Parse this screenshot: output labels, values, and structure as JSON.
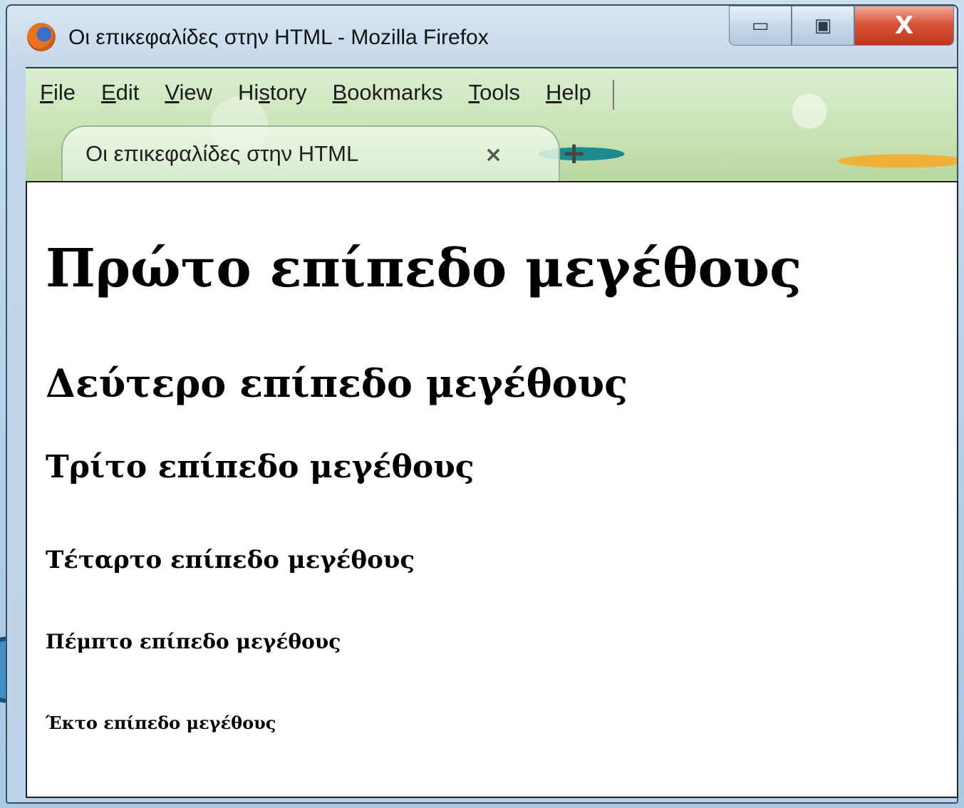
{
  "window": {
    "title": "Οι επικεφαλίδες στην HTML - Mozilla Firefox",
    "minimize_symbol": "▭",
    "maximize_symbol": "▣",
    "close_symbol": "X"
  },
  "menubar": {
    "items": [
      {
        "accel": "F",
        "rest": "ile"
      },
      {
        "accel": "E",
        "rest": "dit"
      },
      {
        "accel": "V",
        "rest": "iew"
      },
      {
        "pre": "Hi",
        "accel": "s",
        "rest": "tory"
      },
      {
        "accel": "B",
        "rest": "ookmarks"
      },
      {
        "accel": "T",
        "rest": "ools"
      },
      {
        "accel": "H",
        "rest": "elp"
      }
    ]
  },
  "tab": {
    "label": "Οι επικεφαλίδες στην HTML",
    "close_symbol": "×",
    "new_tab_symbol": "+"
  },
  "page": {
    "h1": "Πρώτο επίπεδο μεγέθους",
    "h2": "Δεύτερο επίπεδο μεγέθους",
    "h3": "Τρίτο επίπεδο μεγέθους",
    "h4": "Τέταρτο επίπεδο μεγέθους",
    "h5": "Πέμπτο επίπεδο μεγέθους",
    "h6": "Έκτο επίπεδο μεγέθους"
  }
}
